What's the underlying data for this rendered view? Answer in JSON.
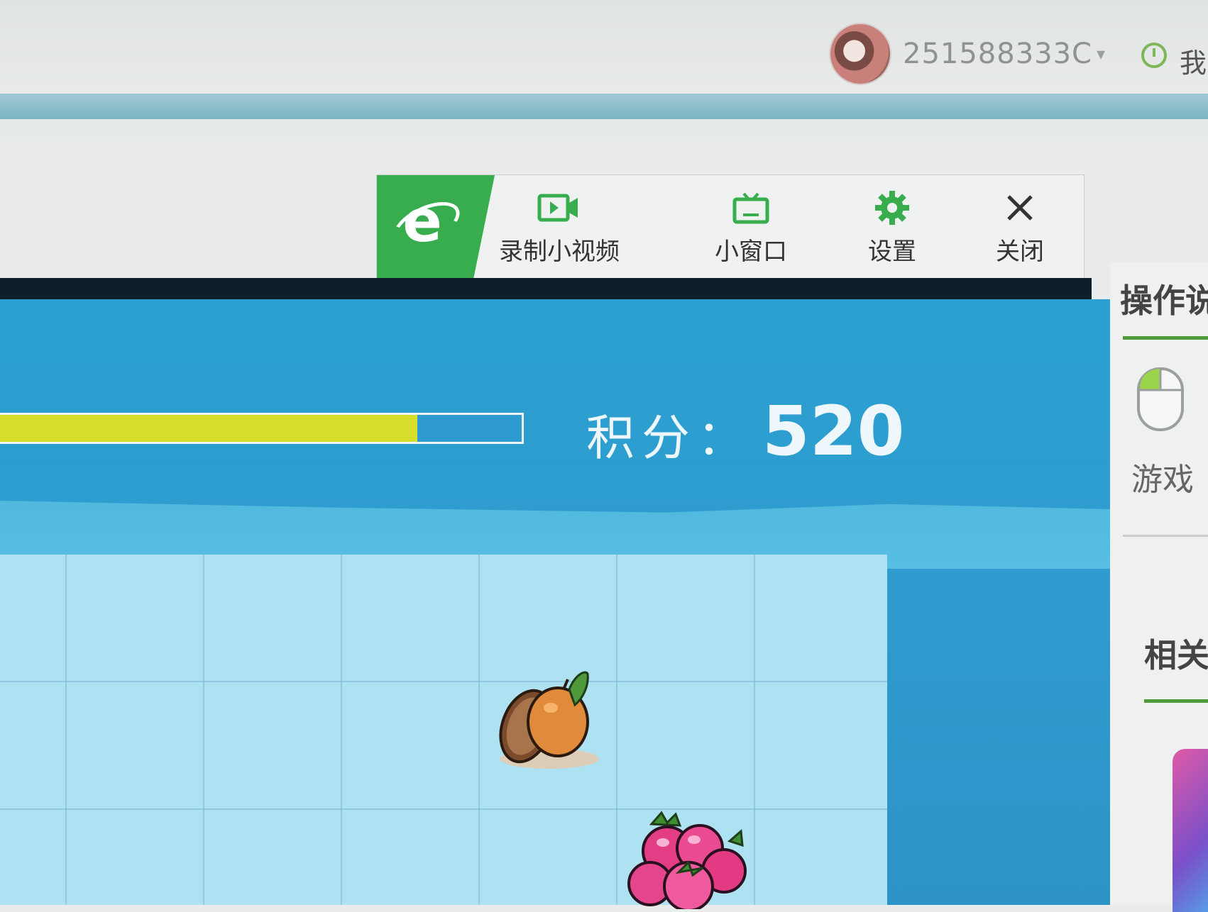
{
  "account": {
    "user_id": "251588333C",
    "menu_label": "我"
  },
  "video_toolbar": {
    "logo_letter": "e",
    "buttons": [
      {
        "label": "录制小视频",
        "icon": "record-video-icon"
      },
      {
        "label": "小窗口",
        "icon": "mini-window-tv-icon"
      },
      {
        "label": "设置",
        "icon": "gear-icon"
      },
      {
        "label": "关闭",
        "icon": "close-icon"
      }
    ]
  },
  "game": {
    "progress_fraction": 0.8,
    "score_label": "积分：",
    "score_value": "520",
    "tiles": [
      {
        "name": "orange",
        "icon": "orange-fruit-icon"
      },
      {
        "name": "radish",
        "icon": "radish-bunch-icon"
      }
    ]
  },
  "sidebar": {
    "instructions_title": "操作说",
    "game_label": "游戏",
    "related_title": "相关"
  },
  "colors": {
    "brand_green": "#37ad4d",
    "game_blue": "#2aa0d0",
    "board_light": "#aee2f3",
    "progress_yellow": "#d9de2c"
  }
}
